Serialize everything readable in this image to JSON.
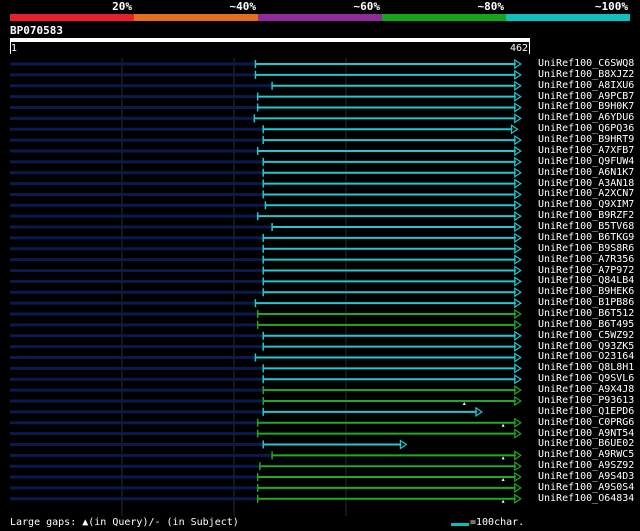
{
  "legend": {
    "labels": [
      "20%",
      "~40%",
      "~60%",
      "~80%",
      "~100%"
    ],
    "colors": [
      "#e8202a",
      "#e46f1e",
      "#8f2b9a",
      "#18a31e",
      "#10c0c0"
    ]
  },
  "query": {
    "name": "BP070583",
    "start": "1",
    "end": "462",
    "length": 462
  },
  "colors": {
    "cyan": "#22c7cf",
    "green": "#24a824",
    "navy": "#0b1a4e",
    "grid": "#2a2a2a",
    "gap": "#ffffff"
  },
  "hits": [
    {
      "name": "UniRef100_C6SWQ8",
      "start": 222,
      "end": 460,
      "color": "cyan"
    },
    {
      "name": "UniRef100_B8XJZ2",
      "start": 222,
      "end": 460,
      "color": "cyan"
    },
    {
      "name": "UniRef100_A8IXU6",
      "start": 237,
      "end": 460,
      "color": "cyan"
    },
    {
      "name": "UniRef100_A9PCB7",
      "start": 224,
      "end": 460,
      "color": "cyan"
    },
    {
      "name": "UniRef100_B9H0K7",
      "start": 224,
      "end": 460,
      "color": "cyan"
    },
    {
      "name": "UniRef100_A6YDU6",
      "start": 221,
      "end": 460,
      "color": "cyan"
    },
    {
      "name": "UniRef100_Q6PQ36",
      "start": 229,
      "end": 457,
      "color": "cyan"
    },
    {
      "name": "UniRef100_B9HRT9",
      "start": 229,
      "end": 460,
      "color": "cyan"
    },
    {
      "name": "UniRef100_A7XFB7",
      "start": 224,
      "end": 460,
      "color": "cyan"
    },
    {
      "name": "UniRef100_Q9FUW4",
      "start": 229,
      "end": 460,
      "color": "cyan"
    },
    {
      "name": "UniRef100_A6N1K7",
      "start": 229,
      "end": 460,
      "color": "cyan"
    },
    {
      "name": "UniRef100_A3AN18",
      "start": 229,
      "end": 460,
      "color": "cyan"
    },
    {
      "name": "UniRef100_A2XCN7",
      "start": 229,
      "end": 460,
      "color": "cyan"
    },
    {
      "name": "UniRef100_Q9XIM7",
      "start": 231,
      "end": 460,
      "color": "cyan"
    },
    {
      "name": "UniRef100_B9RZF2",
      "start": 224,
      "end": 460,
      "color": "cyan"
    },
    {
      "name": "UniRef100_B5TV68",
      "start": 237,
      "end": 460,
      "color": "cyan"
    },
    {
      "name": "UniRef100_B6TKG9",
      "start": 229,
      "end": 460,
      "color": "cyan"
    },
    {
      "name": "UniRef100_B9S8R6",
      "start": 229,
      "end": 460,
      "color": "cyan"
    },
    {
      "name": "UniRef100_A7R356",
      "start": 229,
      "end": 460,
      "color": "cyan"
    },
    {
      "name": "UniRef100_A7P972",
      "start": 229,
      "end": 460,
      "color": "cyan"
    },
    {
      "name": "UniRef100_Q84LB4",
      "start": 229,
      "end": 460,
      "color": "cyan"
    },
    {
      "name": "UniRef100_B9HEK6",
      "start": 229,
      "end": 460,
      "color": "cyan"
    },
    {
      "name": "UniRef100_B1PB86",
      "start": 222,
      "end": 460,
      "color": "cyan"
    },
    {
      "name": "UniRef100_B6T512",
      "start": 224,
      "end": 460,
      "color": "green"
    },
    {
      "name": "UniRef100_B6T495",
      "start": 224,
      "end": 460,
      "color": "green"
    },
    {
      "name": "UniRef100_C5WZ92",
      "start": 229,
      "end": 460,
      "color": "cyan"
    },
    {
      "name": "UniRef100_Q93ZK5",
      "start": 229,
      "end": 460,
      "color": "cyan"
    },
    {
      "name": "UniRef100_O23164",
      "start": 222,
      "end": 460,
      "color": "cyan"
    },
    {
      "name": "UniRef100_Q8L8H1",
      "start": 229,
      "end": 460,
      "color": "cyan"
    },
    {
      "name": "UniRef100_Q9SVL6",
      "start": 229,
      "end": 460,
      "color": "cyan"
    },
    {
      "name": "UniRef100_A9X4J8",
      "start": 229,
      "end": 460,
      "color": "green"
    },
    {
      "name": "UniRef100_P93613",
      "start": 229,
      "end": 460,
      "color": "green",
      "gap": 410
    },
    {
      "name": "UniRef100_Q1EPD6",
      "start": 229,
      "end": 425,
      "color": "cyan"
    },
    {
      "name": "UniRef100_C0PRG6",
      "start": 224,
      "end": 460,
      "color": "green",
      "gap": 445
    },
    {
      "name": "UniRef100_A9NT54",
      "start": 224,
      "end": 460,
      "color": "green"
    },
    {
      "name": "UniRef100_B6UE02",
      "start": 229,
      "end": 357,
      "color": "cyan"
    },
    {
      "name": "UniRef100_A9RWC5",
      "start": 237,
      "end": 460,
      "color": "green",
      "gap": 445
    },
    {
      "name": "UniRef100_A9SZ92",
      "start": 226,
      "end": 460,
      "color": "green"
    },
    {
      "name": "UniRef100_A9S4D3",
      "start": 224,
      "end": 460,
      "color": "green",
      "gap": 445
    },
    {
      "name": "UniRef100_A9S0S4",
      "start": 224,
      "end": 460,
      "color": "green"
    },
    {
      "name": "UniRef100_O64834",
      "start": 224,
      "end": 460,
      "color": "green",
      "gap": 445
    }
  ],
  "footer": {
    "gaps_text": "Large gaps: ▲(in Query)/- (in Subject)",
    "scale_text": "=100char."
  }
}
